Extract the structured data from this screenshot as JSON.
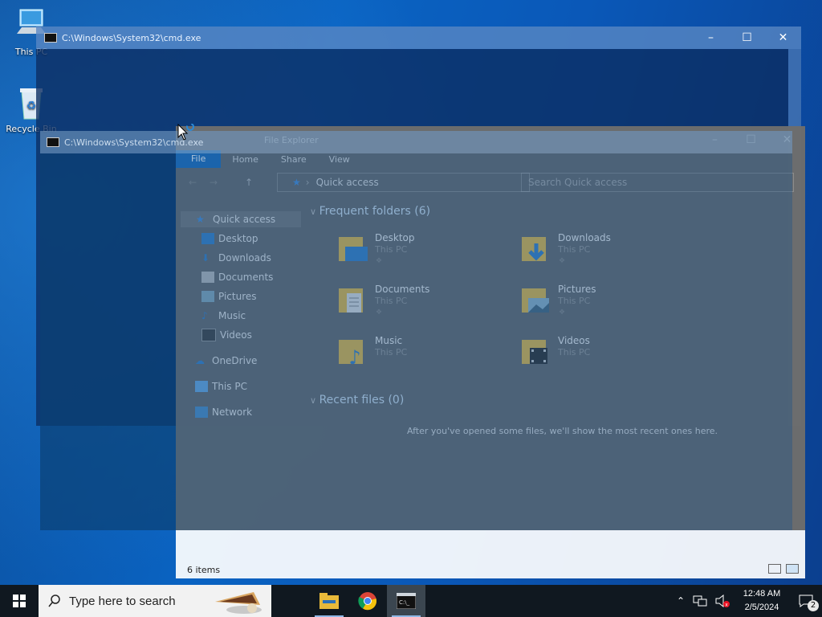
{
  "desktop_icons": [
    {
      "label": "This PC",
      "icon": "this-pc-icon"
    },
    {
      "label": "Recycle Bin",
      "icon": "recycle-bin-icon"
    }
  ],
  "cmd_back": {
    "title": "C:\\Windows\\System32\\cmd.exe"
  },
  "cmd_front": {
    "title": "C:\\Windows\\System32\\cmd.exe"
  },
  "explorer": {
    "title": "File Explorer",
    "ribbon_tabs": [
      "File",
      "Home",
      "Share",
      "View"
    ],
    "address": "Quick access",
    "search_placeholder": "Search Quick access",
    "nav": [
      "Quick access",
      "Desktop",
      "Downloads",
      "Documents",
      "Pictures",
      "Music",
      "Videos",
      "OneDrive",
      "This PC",
      "Network"
    ],
    "frequent_header": "Frequent folders (6)",
    "recent_header": "Recent files (0)",
    "folders": [
      {
        "name": "Desktop",
        "location": "This PC"
      },
      {
        "name": "Downloads",
        "location": "This PC"
      },
      {
        "name": "Documents",
        "location": "This PC"
      },
      {
        "name": "Pictures",
        "location": "This PC"
      },
      {
        "name": "Music",
        "location": "This PC"
      },
      {
        "name": "Videos",
        "location": "This PC"
      }
    ],
    "recent_hint": "After you've opened some files, we'll show the most recent ones here.",
    "status": "6 items"
  },
  "taskbar": {
    "search_placeholder": "Type here to search",
    "apps": [
      "file-explorer-icon",
      "chrome-icon",
      "cmd-icon"
    ],
    "time": "12:48 AM",
    "date": "2/5/2024",
    "notifications": "2"
  },
  "colors": {
    "accent": "#1f6fbd",
    "taskbar": "#101820"
  }
}
